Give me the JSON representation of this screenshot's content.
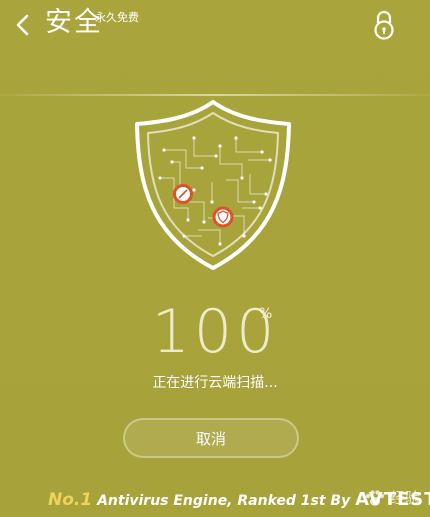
{
  "header": {
    "title": "安全",
    "subtitle": "永久免费"
  },
  "scan": {
    "progress_value": "100",
    "progress_unit": "%",
    "status_text": "正在进行云端扫描...",
    "cancel_label": "取消"
  },
  "footer": {
    "rank_label": "No.1",
    "text": " Antivirus Engine, Ranked 1st By ",
    "brand": "AVTEST"
  },
  "watermark": {
    "text": "经验"
  },
  "icons": {
    "back": "chevron-left-icon",
    "lock": "lock-icon",
    "shield": "shield-icon",
    "paw": "paw-icon"
  },
  "colors": {
    "background": "#a8a33d",
    "accent": "#f0d25c",
    "marker": "#d9542a"
  }
}
